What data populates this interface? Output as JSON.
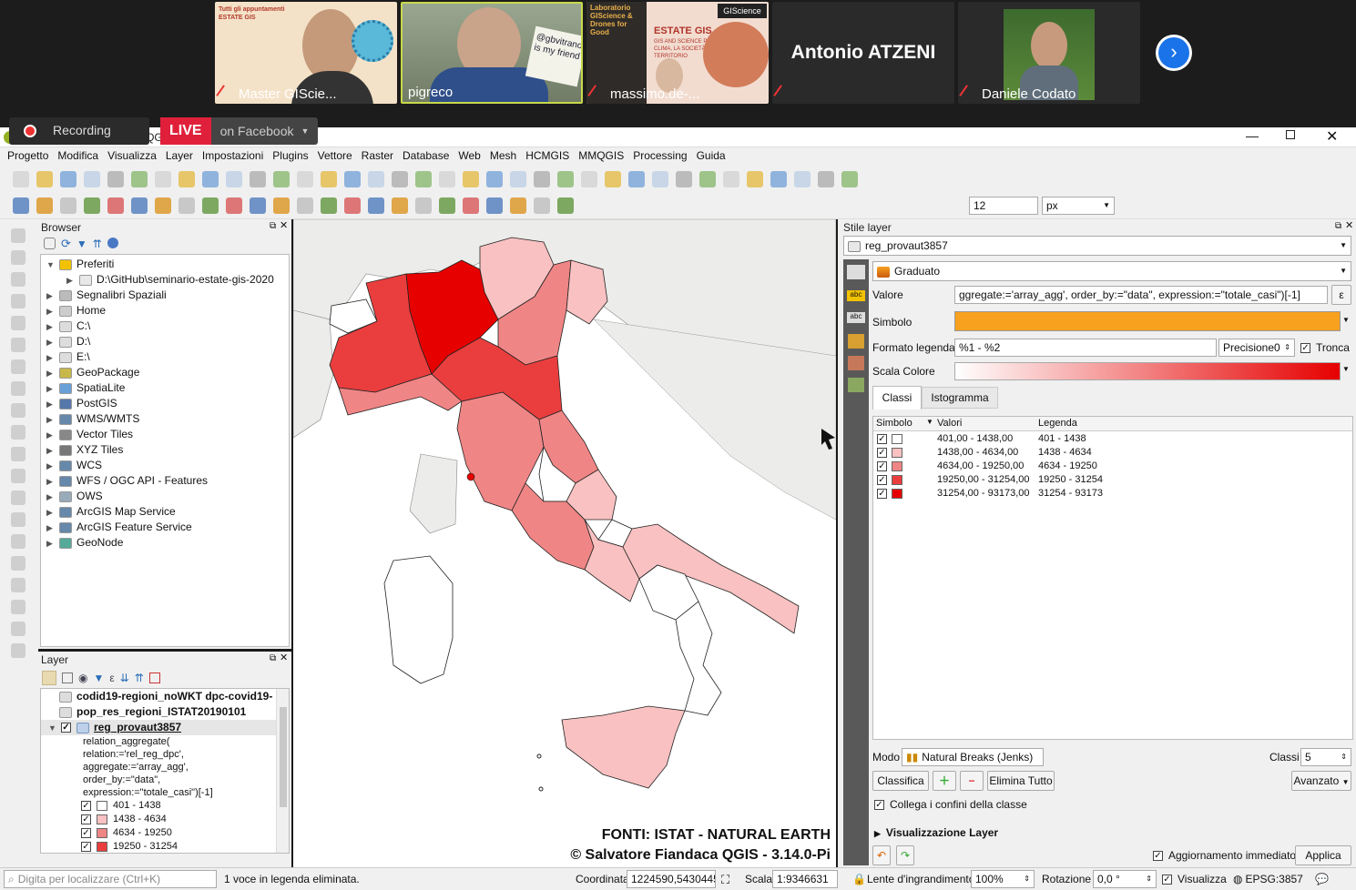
{
  "zoom": {
    "participants": [
      {
        "name": "Master GIScie...",
        "muted": true
      },
      {
        "name": "pigreco",
        "muted": false
      },
      {
        "name": "massimo.de-...",
        "muted": true
      },
      {
        "name": "Antonio ATZENI",
        "muted": true
      },
      {
        "name": "Daniele Codato",
        "muted": true
      }
    ],
    "slide1_lines": [
      "Tutti gli appuntamenti",
      "ESTATE GIS"
    ],
    "slide3_title": "ESTATE GIS",
    "slide3_sub": "GIS AND SCIENCE PER IL CLIMA, LA SOCIETÀ E IL TERRITORIO",
    "slide3_lab": "Laboratorio GIScience & Drones for Good",
    "sign_text": "@gbvitrano is my friend",
    "recording_label": "Recording",
    "live_label": "LIVE",
    "facebook_label": "on Facebook"
  },
  "window": {
    "title": "*Progetto Senza Titolo — QGIS",
    "menu": [
      "Progetto",
      "Modifica",
      "Visualizza",
      "Layer",
      "Impostazioni",
      "Plugins",
      "Vettore",
      "Raster",
      "Database",
      "Web",
      "Mesh",
      "HCMGIS",
      "MMQGIS",
      "Processing",
      "Guida"
    ]
  },
  "toolbar2": {
    "size_value": "12",
    "unit": "px"
  },
  "browser": {
    "title": "Browser",
    "items": [
      {
        "label": "Preferiti",
        "icon": "star-icon",
        "color": "#f2c200"
      },
      {
        "label": "D:\\GitHub\\seminario-estate-gis-2020",
        "icon": "folder-icon",
        "color": "#e8e8e8",
        "indent": true
      },
      {
        "label": "Segnalibri Spaziali",
        "icon": "bookmark-icon",
        "color": "#bbb"
      },
      {
        "label": "Home",
        "icon": "home-folder-icon",
        "color": "#ccc"
      },
      {
        "label": "C:\\",
        "icon": "drive-icon",
        "color": "#ddd"
      },
      {
        "label": "D:\\",
        "icon": "drive-icon",
        "color": "#ddd"
      },
      {
        "label": "E:\\",
        "icon": "drive-icon",
        "color": "#ddd"
      },
      {
        "label": "GeoPackage",
        "icon": "geopackage-icon",
        "color": "#c8b84a"
      },
      {
        "label": "SpatiaLite",
        "icon": "spatialite-icon",
        "color": "#6aa0d8"
      },
      {
        "label": "PostGIS",
        "icon": "postgis-icon",
        "color": "#5577aa"
      },
      {
        "label": "WMS/WMTS",
        "icon": "globe-icon",
        "color": "#6688aa"
      },
      {
        "label": "Vector Tiles",
        "icon": "grid-icon",
        "color": "#888"
      },
      {
        "label": "XYZ Tiles",
        "icon": "grid-icon",
        "color": "#777"
      },
      {
        "label": "WCS",
        "icon": "globe-icon",
        "color": "#6688aa"
      },
      {
        "label": "WFS / OGC API - Features",
        "icon": "globe-icon",
        "color": "#6688aa"
      },
      {
        "label": "OWS",
        "icon": "globe-icon",
        "color": "#9ab"
      },
      {
        "label": "ArcGIS Map Service",
        "icon": "globe-icon",
        "color": "#6688aa"
      },
      {
        "label": "ArcGIS Feature Service",
        "icon": "globe-icon",
        "color": "#6688aa"
      },
      {
        "label": "GeoNode",
        "icon": "geonode-icon",
        "color": "#5a9"
      }
    ]
  },
  "layers": {
    "title": "Layer",
    "table1": "codid19-regioni_noWKT dpc-covid19-",
    "table2": "pop_res_regioni_ISTAT20190101",
    "active": "reg_provaut3857",
    "expr_lines": [
      "relation_aggregate(",
      "relation:='rel_reg_dpc',",
      "aggregate:='array_agg',",
      "order_by:=\"data\",",
      "expression:=\"totale_casi\")[-1]"
    ],
    "legend": [
      {
        "label": "401 - 1438",
        "color": "#ffffff"
      },
      {
        "label": "1438 - 4634",
        "color": "#f9c1c1"
      },
      {
        "label": "4634 - 19250",
        "color": "#f08585"
      },
      {
        "label": "19250 - 31254",
        "color": "#ea3e3e"
      }
    ]
  },
  "map": {
    "caption1": "FONTI: ISTAT - NATURAL EARTH",
    "caption2": "© Salvatore Fiandaca QGIS - 3.14.0-Pi"
  },
  "style": {
    "title": "Stile layer",
    "layer": "reg_provaut3857",
    "renderer": "Graduato",
    "valore_label": "Valore",
    "valore": "ggregate:='array_agg',   order_by:=\"data\",   expression:=\"totale_casi\")[-1]",
    "simbolo_label": "Simbolo",
    "symbol_color": "#f7a11e",
    "formato_label": "Formato legenda",
    "formato": "%1 - %2",
    "precisione": "Precisione0",
    "tronca": "Tronca",
    "scala_label": "Scala Colore",
    "tabs": [
      "Classi",
      "Istogramma"
    ],
    "columns": [
      "Simbolo",
      "Valori",
      "Legenda"
    ],
    "classes": [
      {
        "values": "401,00 - 1438,00",
        "legend": "401 - 1438",
        "color": "#ffffff"
      },
      {
        "values": "1438,00 - 4634,00",
        "legend": "1438 - 4634",
        "color": "#f9c1c1"
      },
      {
        "values": "4634,00 - 19250,00",
        "legend": "4634 - 19250",
        "color": "#f08585"
      },
      {
        "values": "19250,00 - 31254,00",
        "legend": "19250 - 31254",
        "color": "#ea3e3e"
      },
      {
        "values": "31254,00 - 93173,00",
        "legend": "31254 - 93173",
        "color": "#e60000"
      }
    ],
    "modo_label": "Modo",
    "modo": "Natural Breaks (Jenks)",
    "classi_label": "Classi",
    "classi": "5",
    "classifica": "Classifica",
    "elimina": "Elimina Tutto",
    "avanzato": "Avanzato",
    "collega": "Collega i confini della classe",
    "visualizzazione": "Visualizzazione Layer",
    "aggiornamento": "Aggiornamento immediato",
    "applica": "Applica"
  },
  "status": {
    "locator": "Digita per localizzare (Ctrl+K)",
    "message": "1 voce in legenda eliminata.",
    "coord_label": "Coordinata",
    "coord": "1224590,5430445",
    "scala_label": "Scala",
    "scala": "1:9346631",
    "lente_label": "Lente d'ingrandimento",
    "lente": "100%",
    "rot_label": "Rotazione",
    "rot": "0,0 °",
    "render": "Visualizza",
    "crs": "EPSG:3857"
  }
}
